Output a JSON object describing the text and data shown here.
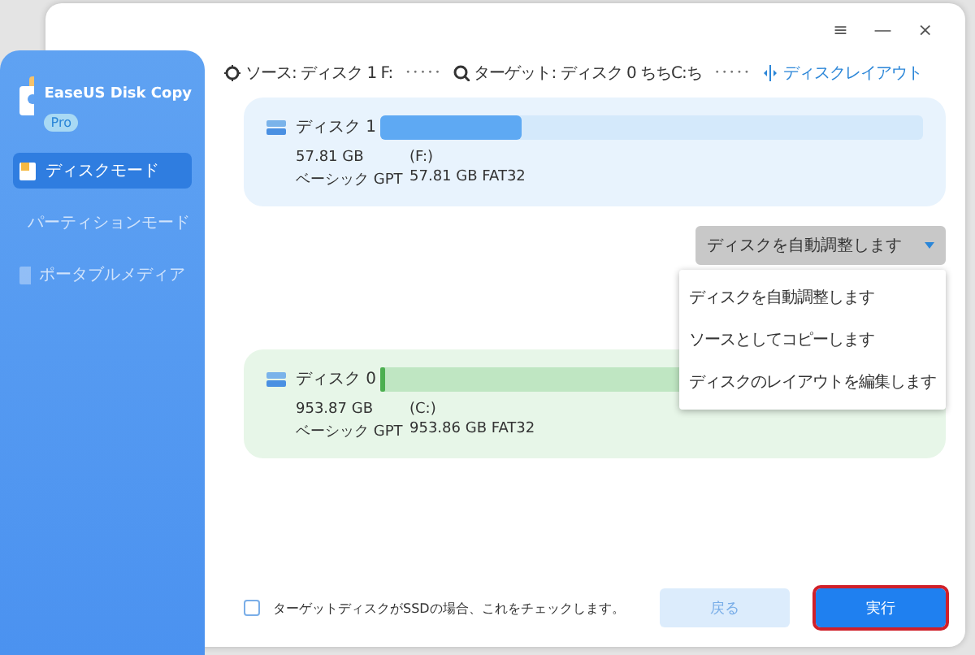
{
  "app": {
    "name": "EaseUS Disk Copy",
    "badge": "Pro"
  },
  "window_controls": [
    "≡",
    "—",
    "×"
  ],
  "sidebar": {
    "items": [
      {
        "label": "ディスクモード",
        "selected": true,
        "disabled": false,
        "kind": "disk"
      },
      {
        "label": "パーティションモード",
        "selected": false,
        "disabled": true,
        "kind": "partition"
      },
      {
        "label": "ポータブルメディア",
        "selected": false,
        "disabled": true,
        "kind": "portable"
      }
    ]
  },
  "header": {
    "source": "ソース: ディスク 1 F:",
    "dots_1": "• • • • •",
    "target": "ターゲット: ディスク 0 ちちC:ち",
    "dots_2": "• • • • •",
    "layout_link": "ディスクレイアウト"
  },
  "disks": [
    {
      "name": "ディスク 1",
      "size": "57.81 GB",
      "type": "ベーシック GPT",
      "partition": "(F:)",
      "partition_info": "57.81 GB FAT32",
      "level": 0.26,
      "kind": "source"
    },
    {
      "name": "ディスク 0",
      "size": "953.87 GB",
      "type": "ベーシック GPT",
      "partition": "(C:)",
      "partition_info": "953.86 GB FAT32",
      "level": 0.01,
      "kind": "target"
    }
  ],
  "dropdown": {
    "value": "ディスクを自動調整します",
    "expanded": true,
    "options": [
      {
        "label": "ディスクを自動調整します"
      },
      {
        "label": "ソースとしてコピーします"
      },
      {
        "label": "ディスクのレイアウトを編集します"
      }
    ]
  },
  "ssd_checkbox": {
    "label": "ターゲットディスクがSSDの場合、これをチェックします。",
    "checked": false
  },
  "buttons": [
    {
      "label": "戻る",
      "kind": "secondary"
    },
    {
      "label": "実行",
      "kind": "primary"
    }
  ]
}
